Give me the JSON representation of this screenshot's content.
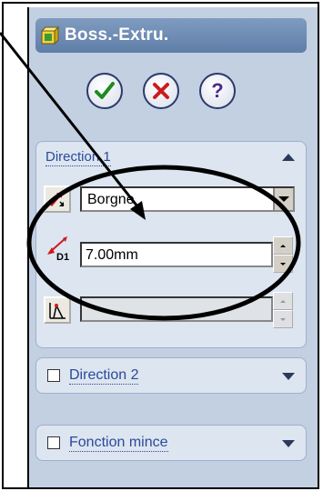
{
  "title": "Boss.-Extru.",
  "buttons": {
    "ok_icon": "checkmark-icon",
    "cancel_icon": "x-icon",
    "help_label": "?"
  },
  "direction1": {
    "label": "Direction 1",
    "end_condition": "Borgne",
    "depth_label": "D1",
    "depth_value": "7.00mm",
    "draft_value": ""
  },
  "direction2": {
    "label": "Direction 2"
  },
  "thin_feature": {
    "label": "Fonction mince"
  },
  "colors": {
    "panel_bg": "#c3d0e2",
    "title_bg": "#6f8db5",
    "group_label": "#2a4a9a",
    "ok_green": "#1f8a1f",
    "cancel_red": "#cc1b1b",
    "help_purple": "#4a2a8a"
  }
}
